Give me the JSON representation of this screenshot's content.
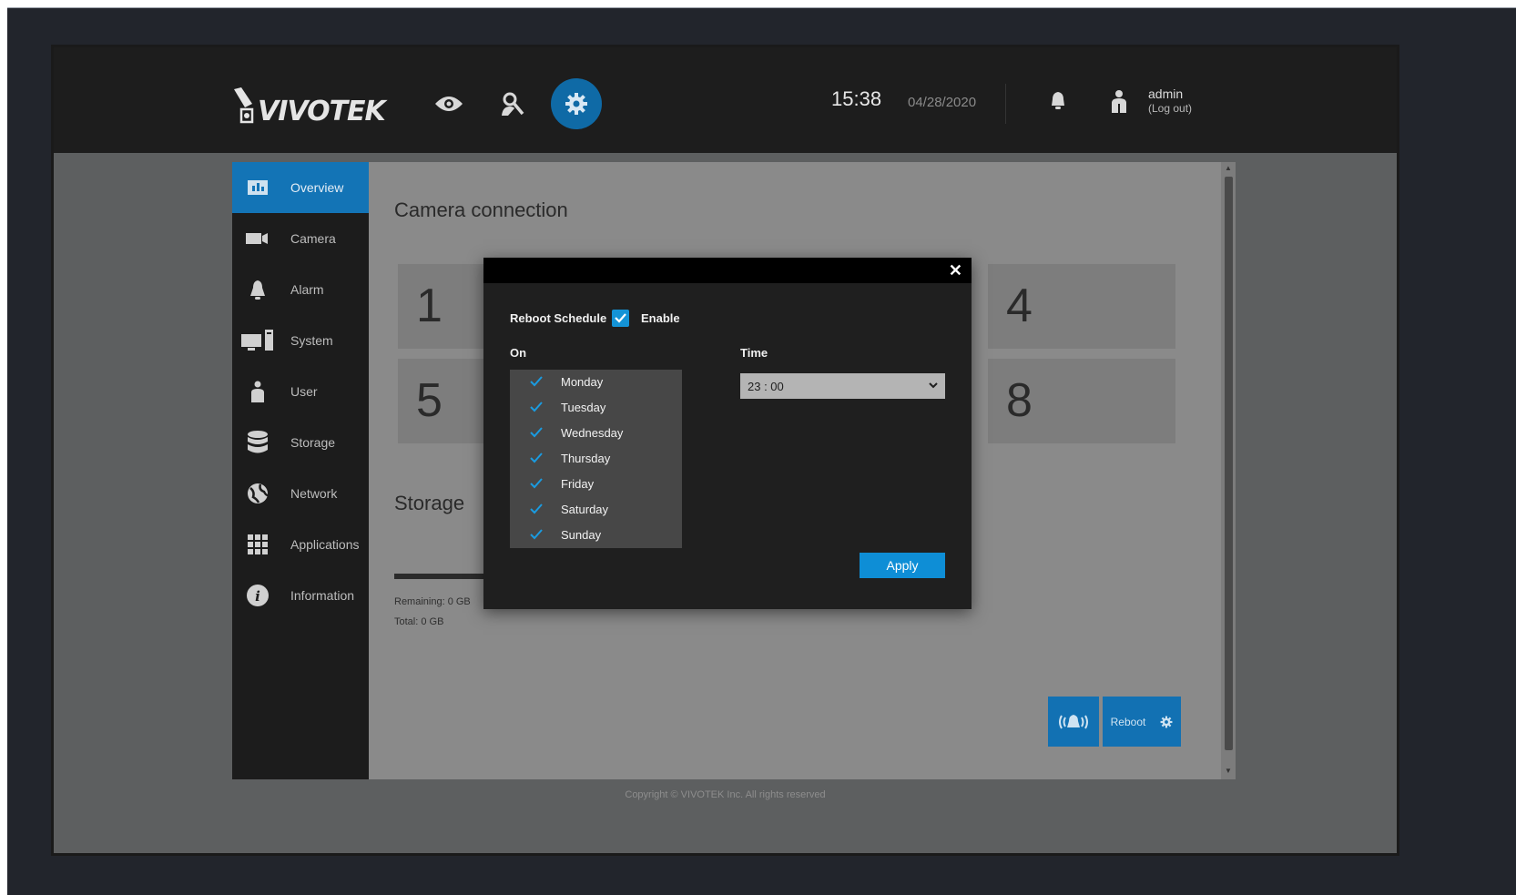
{
  "header": {
    "logo_text": "VIVOTEK",
    "time": "15:38",
    "date": "04/28/2020",
    "user_name": "admin",
    "logout_label": "(Log out)"
  },
  "nav_icons": [
    "eye-icon",
    "search-person-icon",
    "gear-icon"
  ],
  "sidebar": {
    "items": [
      {
        "label": "Overview",
        "icon": "overview-chart-icon",
        "active": true
      },
      {
        "label": "Camera",
        "icon": "video-camera-icon"
      },
      {
        "label": "Alarm",
        "icon": "bell-icon"
      },
      {
        "label": "System",
        "icon": "computer-icon"
      },
      {
        "label": "User",
        "icon": "user-icon"
      },
      {
        "label": "Storage",
        "icon": "database-icon"
      },
      {
        "label": "Network",
        "icon": "globe-icon"
      },
      {
        "label": "Applications",
        "icon": "grid-icon"
      },
      {
        "label": "Information",
        "icon": "info-icon"
      }
    ]
  },
  "content": {
    "camera_title": "Camera connection",
    "tiles": [
      "1",
      "4",
      "5",
      "8"
    ],
    "storage_title": "Storage",
    "remaining": "Remaining: 0 GB",
    "total": "Total: 0 GB",
    "reboot_label": "Reboot"
  },
  "modal": {
    "schedule_label": "Reboot Schedule",
    "enable_label": "Enable",
    "on_label": "On",
    "time_label": "Time",
    "days": [
      "Monday",
      "Tuesday",
      "Wednesday",
      "Thursday",
      "Friday",
      "Saturday",
      "Sunday"
    ],
    "time_value": "23 : 00",
    "apply_label": "Apply"
  },
  "footer": {
    "copyright": "Copyright © VIVOTEK Inc. All rights reserved"
  },
  "colors": {
    "accent": "#1374b6",
    "check_blue": "#1493d6",
    "apply_blue": "#0e8ed6"
  }
}
